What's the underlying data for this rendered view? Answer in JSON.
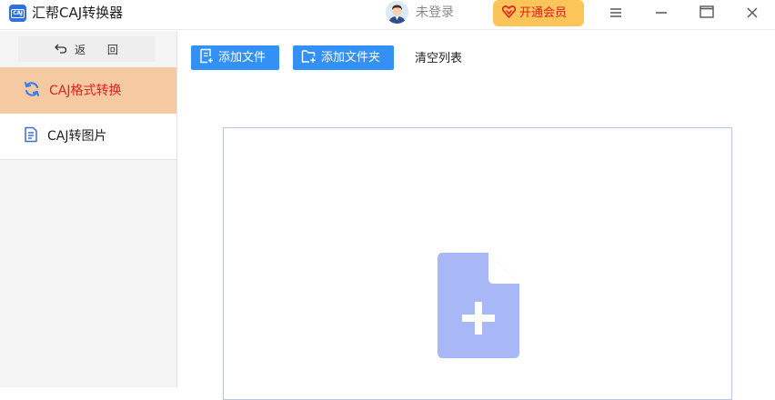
{
  "app": {
    "logo_text": "CAJ",
    "title": "汇帮CAJ转换器"
  },
  "header": {
    "login_text": "未登录",
    "vip_label": "开通会员",
    "colors": {
      "vip_bg": "#fdc45a",
      "vip_text": "#e01b1b"
    },
    "icons": [
      "avatar-icon",
      "heart-diamond-icon",
      "menu-icon",
      "minimize-icon",
      "maximize-icon",
      "close-icon"
    ]
  },
  "sidebar": {
    "back_label": "返 回",
    "items": [
      {
        "label": "CAJ格式转换",
        "icon": "refresh-icon",
        "active": true
      },
      {
        "label": "CAJ转图片",
        "icon": "document-icon",
        "active": false
      }
    ],
    "colors": {
      "active_bg": "#f5c9a2",
      "active_text": "#e3201b"
    }
  },
  "toolbar": {
    "add_file_label": "添加文件",
    "add_folder_label": "添加文件夹",
    "clear_label": "清空列表",
    "colors": {
      "button_bg": "#3390f4"
    }
  },
  "dropzone": {
    "icon": "add-file-icon",
    "colors": {
      "icon_fill": "#a8b7f5",
      "border": "#b9c6e6"
    }
  }
}
